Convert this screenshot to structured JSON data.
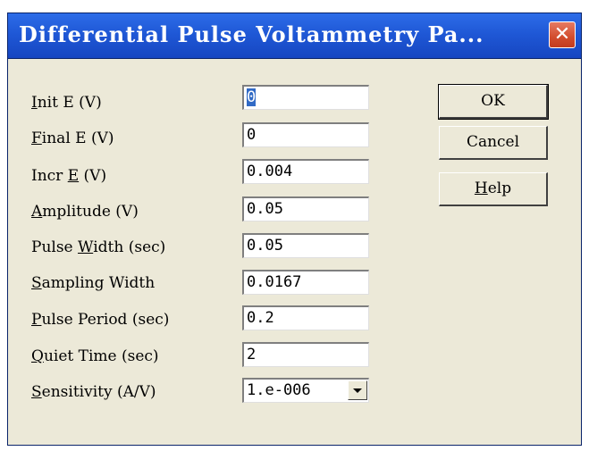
{
  "window": {
    "title": "Differential Pulse Voltammetry Pa...",
    "close_glyph": "✕"
  },
  "parameters": [
    {
      "label_mnemonic": "I",
      "label_rest": "nit E (V)",
      "value": "0"
    },
    {
      "label_mnemonic": "F",
      "label_rest": "inal E (V)",
      "value": "0"
    },
    {
      "label_pre": "Incr ",
      "label_mnemonic": "E",
      "label_rest": " (V)",
      "value": "0.004"
    },
    {
      "label_mnemonic": "A",
      "label_rest": "mplitude (V)",
      "value": "0.05"
    },
    {
      "label_pre": "Pulse ",
      "label_mnemonic": "W",
      "label_rest": "idth (sec)",
      "value": "0.05"
    },
    {
      "label_mnemonic": "S",
      "label_rest": "ampling Width",
      "value": "0.0167"
    },
    {
      "label_mnemonic": "P",
      "label_rest": "ulse Period (sec)",
      "value": "0.2"
    },
    {
      "label_mnemonic": "Q",
      "label_rest": "uiet Time (sec)",
      "value": "2"
    },
    {
      "label_mnemonic": "S",
      "label_rest": "ensitivity (A/V)",
      "value": "1.e-006"
    }
  ],
  "buttons": {
    "ok": "OK",
    "cancel": "Cancel",
    "help_mnemonic": "H",
    "help_rest": "elp"
  },
  "colors": {
    "titlebar": "#1f58d6",
    "dialog_bg": "#ece9d8",
    "close_button": "#d24c2d",
    "selection": "#316ac5"
  }
}
